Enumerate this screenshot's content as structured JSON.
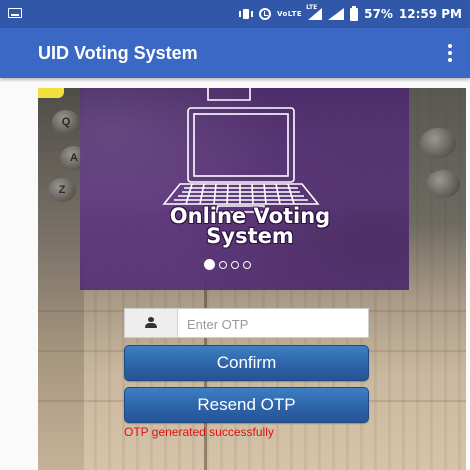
{
  "status_bar": {
    "volte": "VoLTE",
    "lte": "LTE",
    "battery": "57%",
    "time": "12:59 PM"
  },
  "app_bar": {
    "title": "UID Voting System"
  },
  "banner": {
    "title_line1": "Online Voting",
    "title_line2": "System",
    "slide_count": 4,
    "active_slide": 1
  },
  "background": {
    "keys": [
      "Q",
      "A",
      "Z"
    ]
  },
  "otp": {
    "placeholder": "Enter OTP",
    "value": ""
  },
  "buttons": {
    "confirm": "Confirm",
    "resend": "Resend OTP"
  },
  "message": {
    "text": "OTP generated successfully",
    "color": "#e01010"
  },
  "colors": {
    "status_bar": "#3158a8",
    "app_bar": "#3a68c4",
    "button": "#2c62a6",
    "banner": "#5e3486"
  }
}
